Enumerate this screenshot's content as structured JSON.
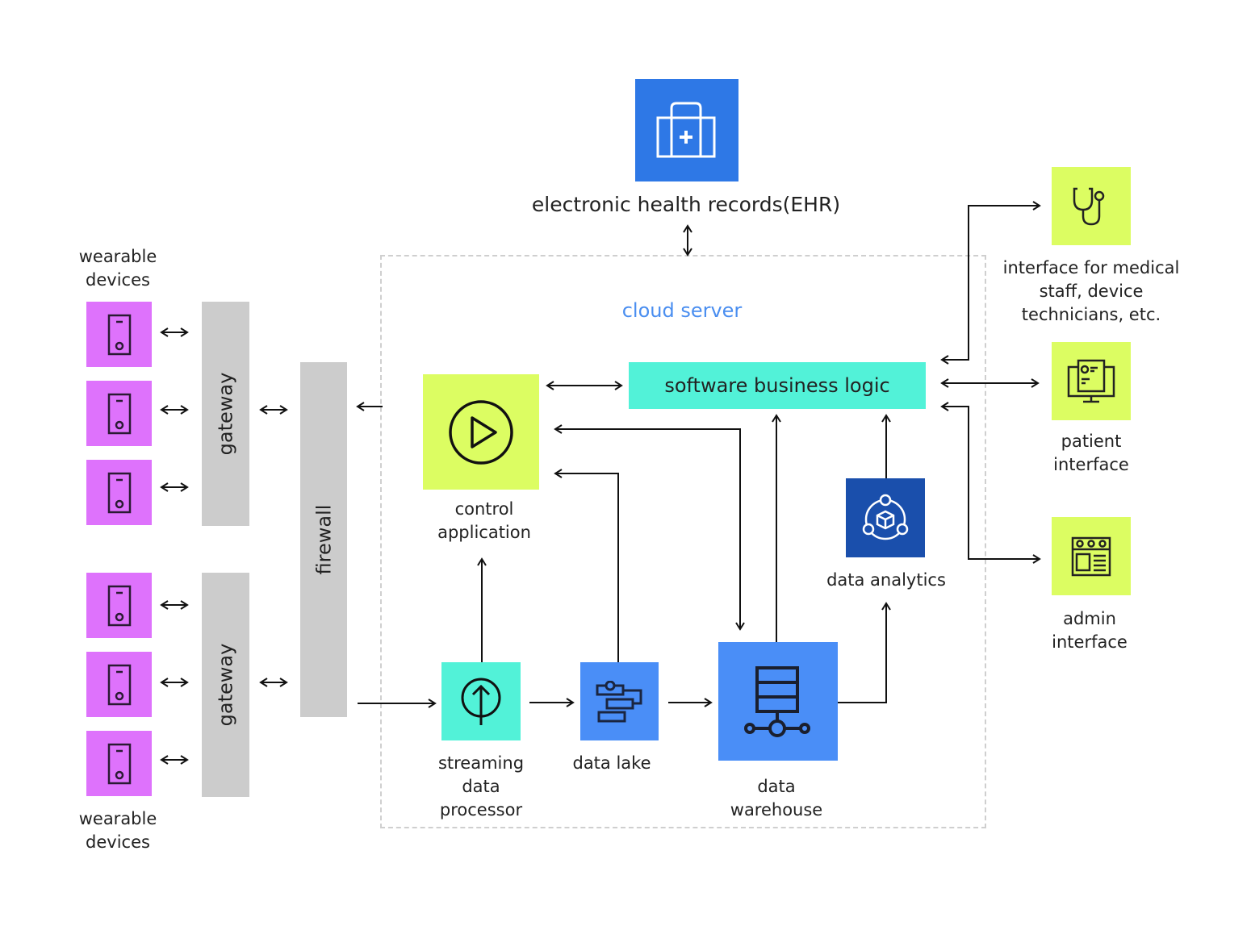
{
  "colors": {
    "device": "#de72fc",
    "gray_bar": "#cccccc",
    "lime": "#dcfd62",
    "teal": "#52f2d8",
    "blue": "#4a8ef7",
    "ehr_blue": "#2e78e6",
    "dark_blue": "#1a4fac",
    "cloud_label": "#4a8ef0",
    "line": "#111111"
  },
  "ehr": {
    "label": "electronic health records(EHR)",
    "icon": "medical-case-icon"
  },
  "cloud": {
    "label": "cloud server"
  },
  "wearables": {
    "top_label": "wearable\ndevices",
    "bottom_label": "wearable\ndevices",
    "icon": "wearable-device-icon",
    "count_per_group": 3
  },
  "gateways": [
    {
      "label": "gateway"
    },
    {
      "label": "gateway"
    }
  ],
  "firewall": {
    "label": "firewall"
  },
  "components": {
    "business_logic": {
      "label": "software business logic"
    },
    "control_app": {
      "label": "control\napplication",
      "icon": "play-circle-icon"
    },
    "streaming": {
      "label": "streaming\ndata\nprocessor",
      "icon": "upload-circle-icon"
    },
    "data_lake": {
      "label": "data lake",
      "icon": "data-lake-icon"
    },
    "warehouse": {
      "label": "data\nwarehouse",
      "icon": "database-network-icon"
    },
    "analytics": {
      "label": "data analytics",
      "icon": "cube-network-icon"
    }
  },
  "interfaces": [
    {
      "label": "interface for medical\nstaff, device\ntechnicians, etc.",
      "icon": "stethoscope-icon"
    },
    {
      "label": "patient\ninterface",
      "icon": "monitor-document-icon"
    },
    {
      "label": "admin\ninterface",
      "icon": "admin-window-icon"
    }
  ]
}
